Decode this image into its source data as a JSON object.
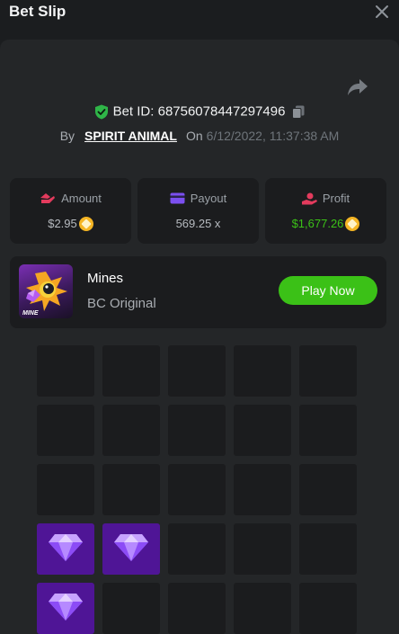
{
  "header": {
    "title": "Bet Slip",
    "close_icon": "close-icon"
  },
  "bet": {
    "id_label": "Bet ID: 68756078447297496",
    "by_label": "By",
    "username": "SPIRIT ANIMAL",
    "on_label": "On",
    "date": "6/12/2022, 11:37:38 AM"
  },
  "stats": [
    {
      "label": "Amount",
      "value": "$2.95",
      "icon": "amount-icon",
      "color": "#e33b5d"
    },
    {
      "label": "Payout",
      "value": "569.25 x",
      "icon": "payout-icon",
      "color": "#7b4ff0"
    },
    {
      "label": "Profit",
      "value": "$1,677.26",
      "icon": "profit-icon",
      "color": "#e33b5d"
    }
  ],
  "game": {
    "name": "Mines",
    "subtitle": "BC Original",
    "thumb_text": "MINE",
    "play_label": "Play Now"
  },
  "colors": {
    "accent_green": "#3bc117",
    "gem_tile": "#4f1596",
    "panel": "#242628"
  },
  "grid": {
    "rows": 5,
    "cols": 5,
    "gem_tiles": [
      [
        3,
        0
      ],
      [
        3,
        1
      ],
      [
        4,
        0
      ]
    ]
  }
}
